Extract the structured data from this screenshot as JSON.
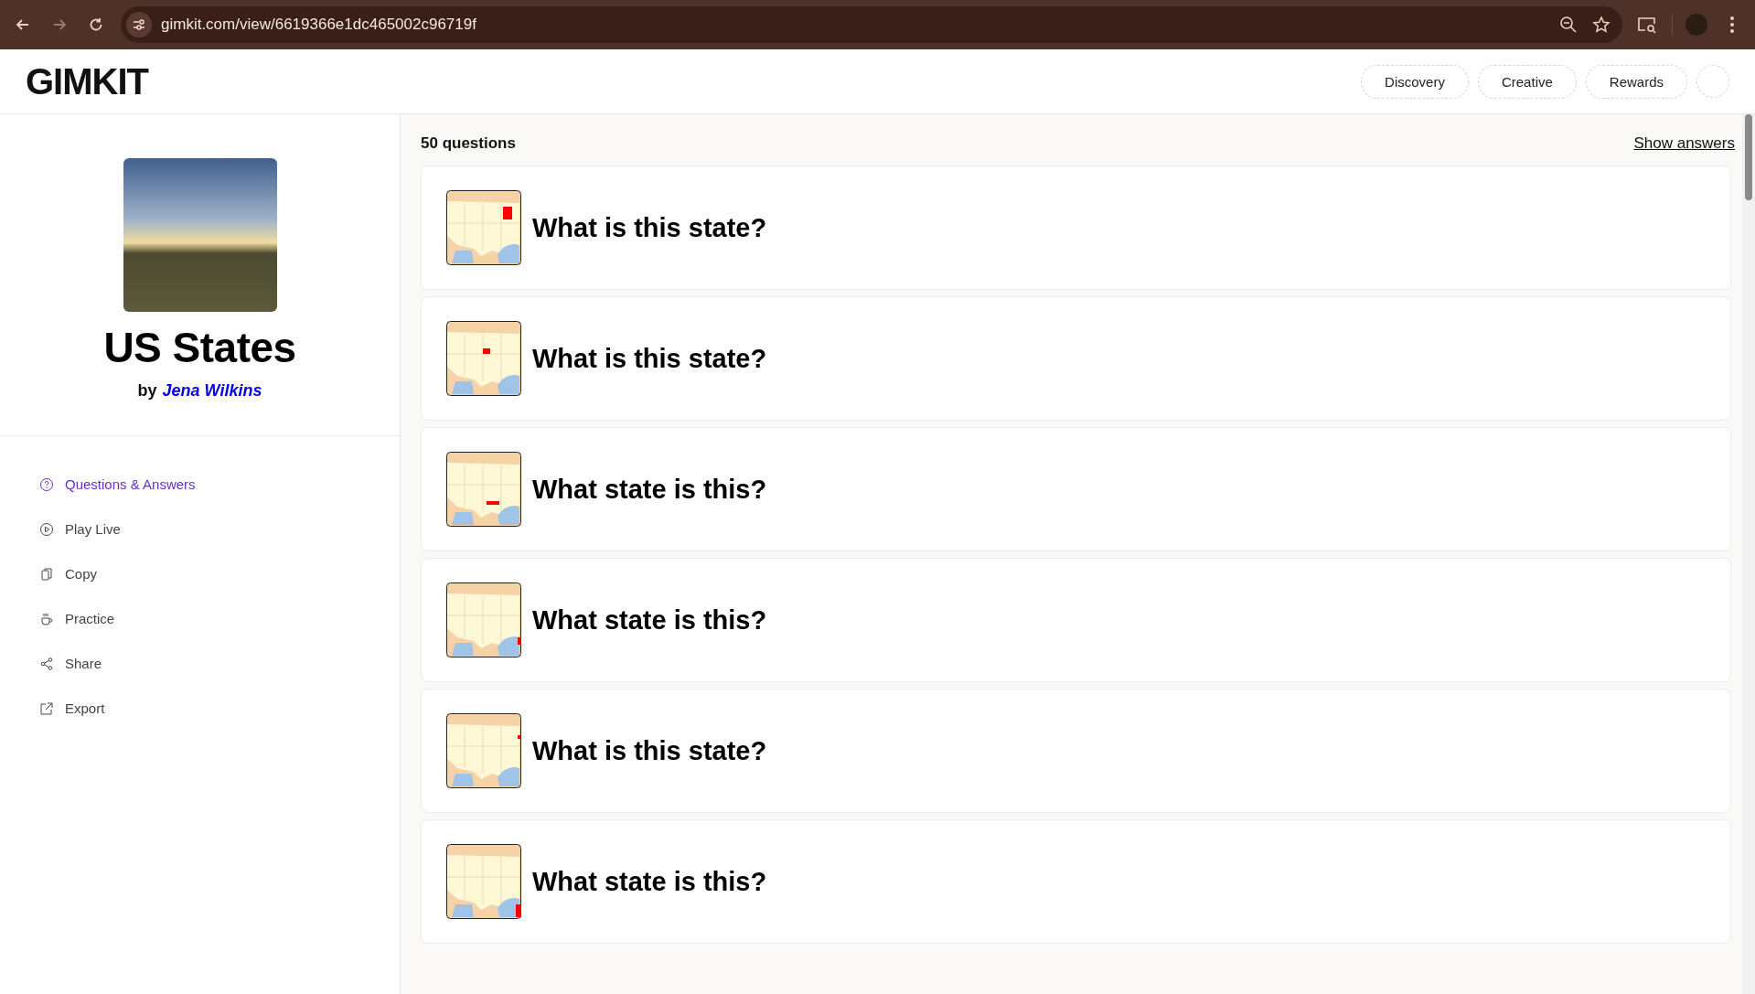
{
  "browser": {
    "url": "gimkit.com/view/6619366e1dc465002c96719f"
  },
  "header": {
    "logo": "GIMKIT",
    "nav": [
      {
        "label": "Discovery"
      },
      {
        "label": "Creative"
      },
      {
        "label": "Rewards"
      }
    ]
  },
  "kit": {
    "title": "US States",
    "by": "by",
    "author": "Jena Wilkins"
  },
  "sidebar": {
    "items": [
      {
        "label": "Questions & Answers",
        "selected": true
      },
      {
        "label": "Play Live",
        "selected": false
      },
      {
        "label": "Copy",
        "selected": false
      },
      {
        "label": "Practice",
        "selected": false
      },
      {
        "label": "Share",
        "selected": false
      },
      {
        "label": "Export",
        "selected": false
      }
    ]
  },
  "questions": {
    "count": "50 questions",
    "show_answers": "Show answers",
    "items": [
      {
        "text": "What is this state?"
      },
      {
        "text": "What is this state?"
      },
      {
        "text": "What state is this?"
      },
      {
        "text": "What state is this?"
      },
      {
        "text": "What is this state?"
      },
      {
        "text": "What state is this?"
      }
    ]
  }
}
